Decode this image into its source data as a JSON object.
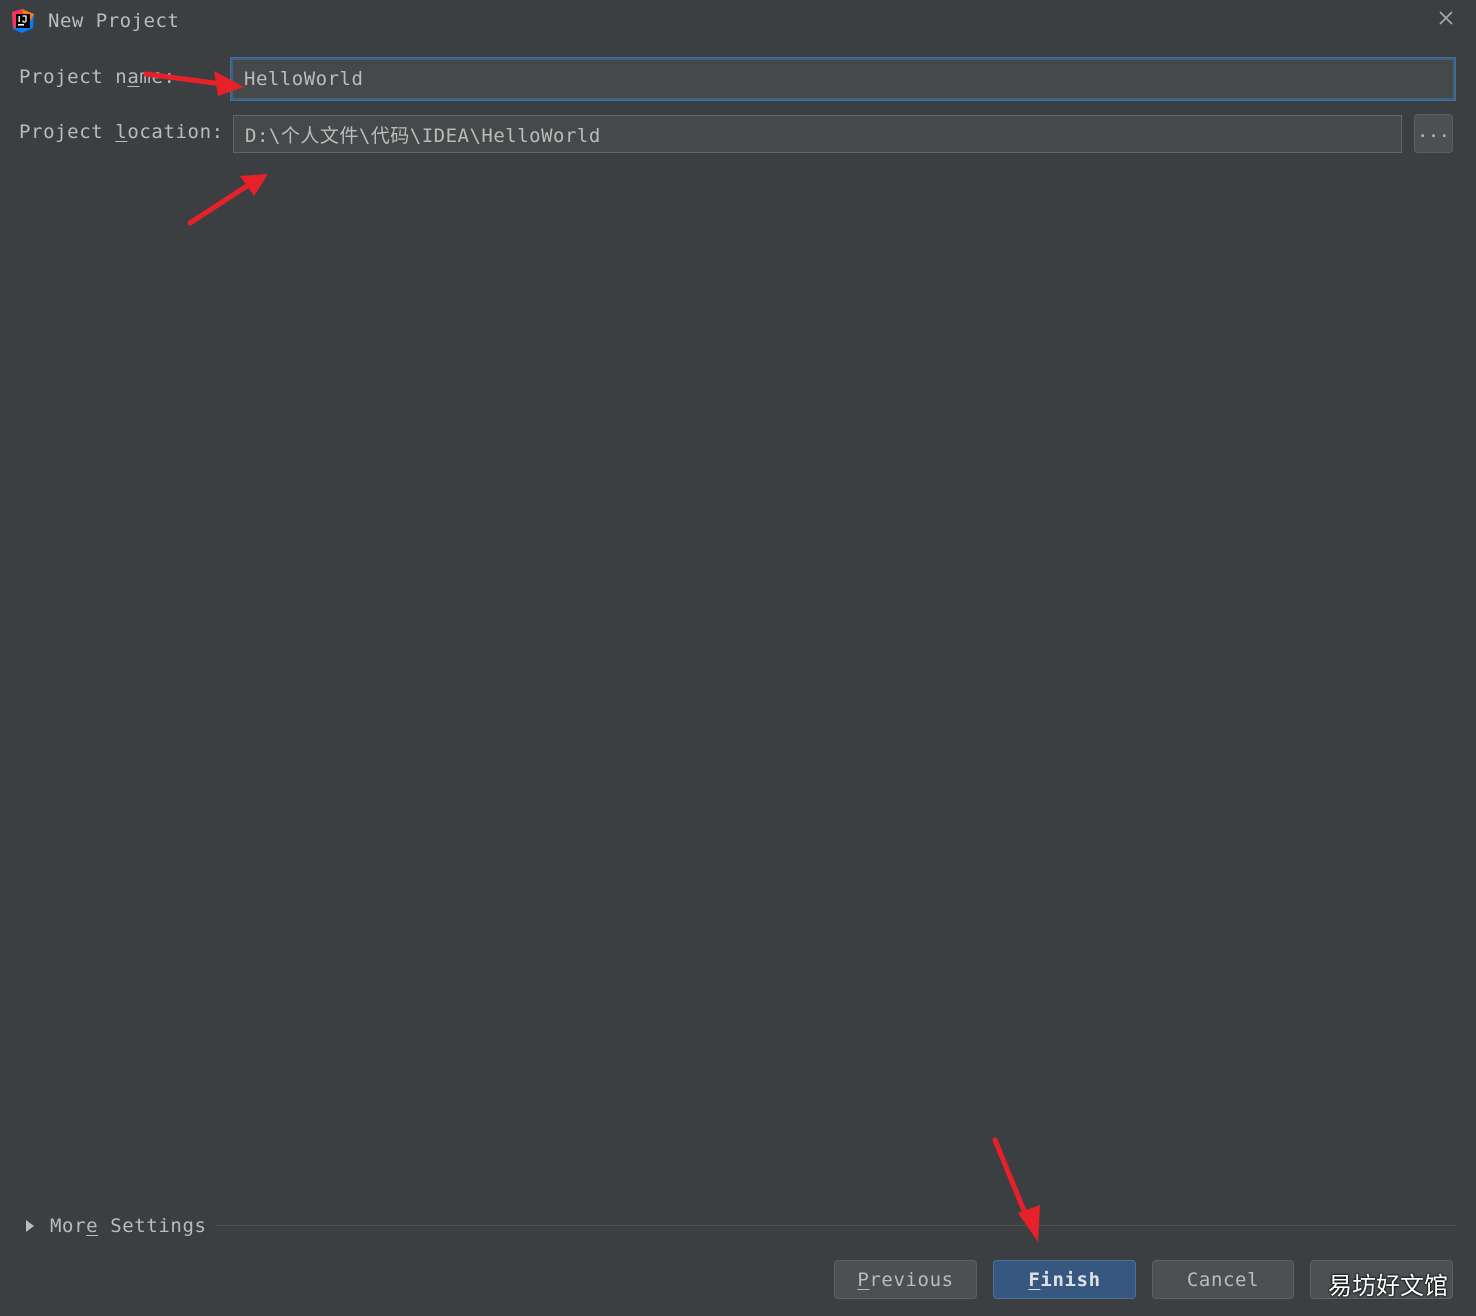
{
  "window": {
    "title": "New Project",
    "icon": "intellij-idea-icon",
    "close_icon": "close-icon"
  },
  "form": {
    "name_label_pre": "Project n",
    "name_label_ul": "a",
    "name_label_post": "me:",
    "name_value": "HelloWorld",
    "location_label_pre": "Project ",
    "location_label_ul": "l",
    "location_label_post": "ocation:",
    "location_value": "D:\\个人文件\\代码\\IDEA\\HelloWorld",
    "browse_label": "..."
  },
  "more_settings": {
    "label_pre": "Mor",
    "label_ul": "e",
    "label_post": " Settings"
  },
  "buttons": {
    "previous_ul": "P",
    "previous_rest": "revious",
    "finish_ul": "F",
    "finish_rest": "inish",
    "cancel": "Cancel"
  },
  "watermark": "易坊好文馆",
  "colors": {
    "background": "#3c3f41",
    "field": "#45494a",
    "focus_border": "#3d6185",
    "primary_button": "#365880",
    "annotation_arrow": "#e8202a"
  }
}
